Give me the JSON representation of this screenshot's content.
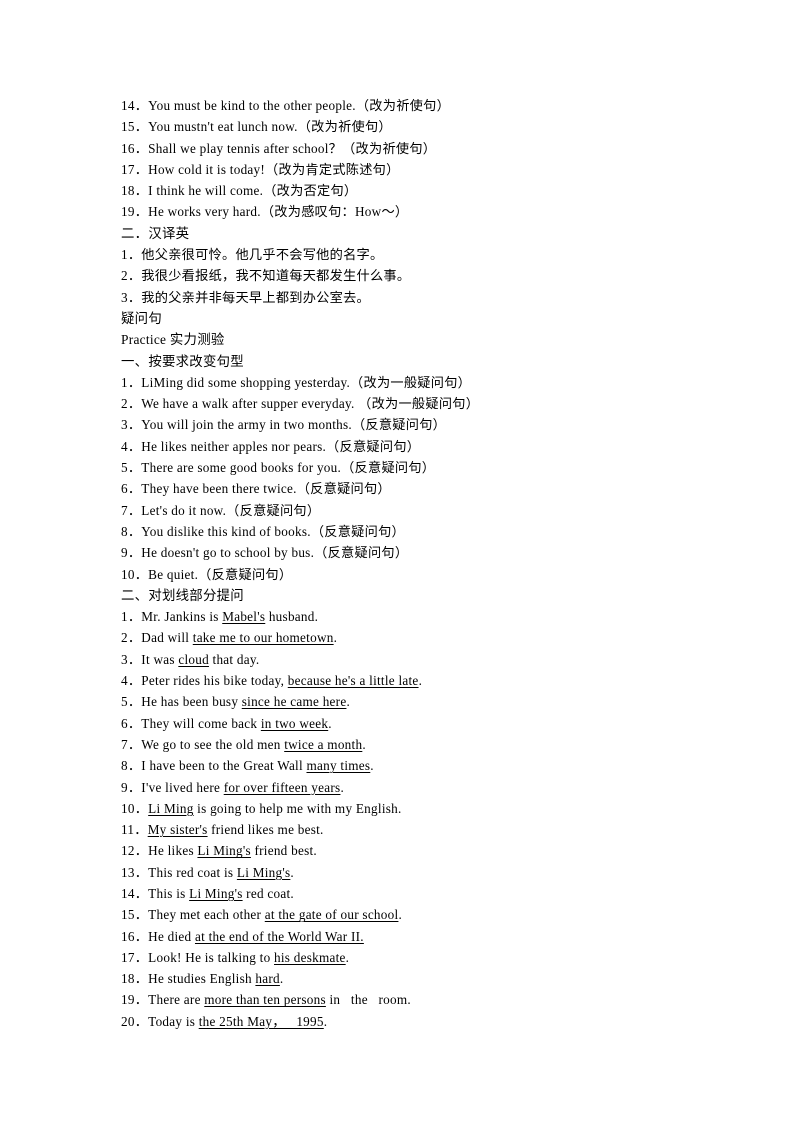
{
  "document": {
    "page_background": "#ffffff",
    "text_color": "#000000",
    "lines": [
      {
        "id": "l1",
        "style": "numbered",
        "text": "14．You must be kind to the other people.（改为祈使句）"
      },
      {
        "id": "l2",
        "style": "numbered",
        "text": "15．You mustn't eat lunch now.（改为祈使句）"
      },
      {
        "id": "l3",
        "style": "numbered",
        "text": "16．Shall we play tennis after school？（改为祈使句）"
      },
      {
        "id": "l4",
        "style": "numbered",
        "text": "17．How cold it is today!（改为肯定式陈述句）"
      },
      {
        "id": "l5",
        "style": "numbered",
        "text": "18．I think he will come.（改为否定句）"
      },
      {
        "id": "l6",
        "style": "numbered",
        "text": "19．He works very hard.（改为感叹句：How～）"
      },
      {
        "id": "l7",
        "style": "heading",
        "text": "二．汉译英"
      },
      {
        "id": "l8",
        "style": "numbered",
        "text": "1．他父亲很可怜。他几乎不会写他的名字。"
      },
      {
        "id": "l9",
        "style": "numbered",
        "text": "2．我很少看报纸，我不知道每天都发生什么事。"
      },
      {
        "id": "l10",
        "style": "numbered",
        "text": "3．我的父亲并非每天早上都到办公室去。"
      },
      {
        "id": "l11",
        "style": "plain",
        "text": "疑问句"
      },
      {
        "id": "l12",
        "style": "plain",
        "text": "Practice 实力测验"
      },
      {
        "id": "l13",
        "style": "heading",
        "text": "一、按要求改变句型"
      },
      {
        "id": "l14",
        "style": "numbered",
        "text": "1．LiMing did some shopping yesterday.（改为一般疑问句）"
      },
      {
        "id": "l15",
        "style": "numbered",
        "text": "2．We have a walk after supper everyday. （改为一般疑问句）"
      },
      {
        "id": "l16",
        "style": "numbered",
        "text": "3．You will join the army in two months.（反意疑问句）"
      },
      {
        "id": "l17",
        "style": "numbered",
        "text": "4．He likes neither apples nor pears.（反意疑问句）"
      },
      {
        "id": "l18",
        "style": "numbered",
        "text": "5．There are some good books for you.（反意疑问句）"
      },
      {
        "id": "l19",
        "style": "numbered",
        "text": "6．They have been there twice.（反意疑问句）"
      },
      {
        "id": "l20",
        "style": "numbered",
        "text": "7．Let's do it now.（反意疑问句）"
      },
      {
        "id": "l21",
        "style": "numbered",
        "text": "8．You dislike this kind of books.（反意疑问句）"
      },
      {
        "id": "l22",
        "style": "numbered",
        "text": "9．He doesn't go to school by bus.（反意疑问句）"
      },
      {
        "id": "l23",
        "style": "numbered",
        "text": "10．Be quiet.（反意疑问句）"
      },
      {
        "id": "l24",
        "style": "heading",
        "text": "二、对划线部分提问"
      },
      {
        "id": "l25",
        "style": "underlined",
        "parts": [
          {
            "t": "1．Mr. Jankins is ",
            "u": false
          },
          {
            "t": "Mabel's",
            "u": true
          },
          {
            "t": " husband.",
            "u": false
          }
        ]
      },
      {
        "id": "l26",
        "style": "underlined",
        "parts": [
          {
            "t": "2．Dad will ",
            "u": false
          },
          {
            "t": "take me to our hometown",
            "u": true
          },
          {
            "t": ".",
            "u": false
          }
        ]
      },
      {
        "id": "l27",
        "style": "underlined",
        "parts": [
          {
            "t": "3．It was ",
            "u": false
          },
          {
            "t": "cloud",
            "u": true
          },
          {
            "t": " that day.",
            "u": false
          }
        ]
      },
      {
        "id": "l28",
        "style": "underlined",
        "parts": [
          {
            "t": "4．Peter rides his bike today, ",
            "u": false
          },
          {
            "t": "because he's a little late",
            "u": true
          },
          {
            "t": ".",
            "u": false
          }
        ]
      },
      {
        "id": "l29",
        "style": "underlined",
        "parts": [
          {
            "t": "5．He has been busy ",
            "u": false
          },
          {
            "t": "since he came here",
            "u": true
          },
          {
            "t": ".",
            "u": false
          }
        ]
      },
      {
        "id": "l30",
        "style": "underlined",
        "parts": [
          {
            "t": "6．They will come back ",
            "u": false
          },
          {
            "t": "in two week",
            "u": true
          },
          {
            "t": ".",
            "u": false
          }
        ]
      },
      {
        "id": "l31",
        "style": "underlined",
        "parts": [
          {
            "t": "7．We go to see the old men ",
            "u": false
          },
          {
            "t": "twice a month",
            "u": true
          },
          {
            "t": ".",
            "u": false
          }
        ]
      },
      {
        "id": "l32",
        "style": "underlined",
        "parts": [
          {
            "t": "8．I have been to the Great Wall ",
            "u": false
          },
          {
            "t": "many times",
            "u": true
          },
          {
            "t": ".",
            "u": false
          }
        ]
      },
      {
        "id": "l33",
        "style": "underlined",
        "parts": [
          {
            "t": "9．I've lived here ",
            "u": false
          },
          {
            "t": "for over fifteen years",
            "u": true
          },
          {
            "t": ".",
            "u": false
          }
        ]
      },
      {
        "id": "l34",
        "style": "underlined",
        "parts": [
          {
            "t": "10．",
            "u": false
          },
          {
            "t": "Li Ming",
            "u": true
          },
          {
            "t": " is going to help me with my English.",
            "u": false
          }
        ]
      },
      {
        "id": "l35",
        "style": "underlined",
        "parts": [
          {
            "t": "11．",
            "u": false
          },
          {
            "t": "My sister's",
            "u": true
          },
          {
            "t": " friend likes me best.",
            "u": false
          }
        ]
      },
      {
        "id": "l36",
        "style": "underlined",
        "parts": [
          {
            "t": "12．He likes ",
            "u": false
          },
          {
            "t": "Li Ming's",
            "u": true
          },
          {
            "t": " friend best.",
            "u": false
          }
        ]
      },
      {
        "id": "l37",
        "style": "underlined",
        "parts": [
          {
            "t": "13．This red coat is ",
            "u": false
          },
          {
            "t": "Li Ming's",
            "u": true
          },
          {
            "t": ".",
            "u": false
          }
        ]
      },
      {
        "id": "l38",
        "style": "underlined",
        "parts": [
          {
            "t": "14．This is ",
            "u": false
          },
          {
            "t": "Li Ming's",
            "u": true
          },
          {
            "t": " red coat.",
            "u": false
          }
        ]
      },
      {
        "id": "l39",
        "style": "underlined",
        "parts": [
          {
            "t": "15．They met each other ",
            "u": false
          },
          {
            "t": "at the gate of our school",
            "u": true
          },
          {
            "t": ".",
            "u": false
          }
        ]
      },
      {
        "id": "l40",
        "style": "underlined",
        "parts": [
          {
            "t": "16．He died ",
            "u": false
          },
          {
            "t": "at the end of the World War II.",
            "u": true
          }
        ]
      },
      {
        "id": "l41",
        "style": "underlined",
        "parts": [
          {
            "t": "17．Look! He is talking to ",
            "u": false
          },
          {
            "t": "his deskmate",
            "u": true
          },
          {
            "t": ".",
            "u": false
          }
        ]
      },
      {
        "id": "l42",
        "style": "underlined",
        "parts": [
          {
            "t": "18．He studies English ",
            "u": false
          },
          {
            "t": "hard",
            "u": true
          },
          {
            "t": ".",
            "u": false
          }
        ]
      },
      {
        "id": "l43",
        "style": "underlined",
        "parts": [
          {
            "t": "19．There are ",
            "u": false
          },
          {
            "t": "more than ten persons",
            "u": true
          },
          {
            "t": " in   the   room.",
            "u": false
          }
        ]
      },
      {
        "id": "l44",
        "style": "underlined",
        "parts": [
          {
            "t": "20．Today is ",
            "u": false
          },
          {
            "t": "the 25th May，   1995",
            "u": true
          },
          {
            "t": ".",
            "u": false
          }
        ]
      }
    ]
  }
}
